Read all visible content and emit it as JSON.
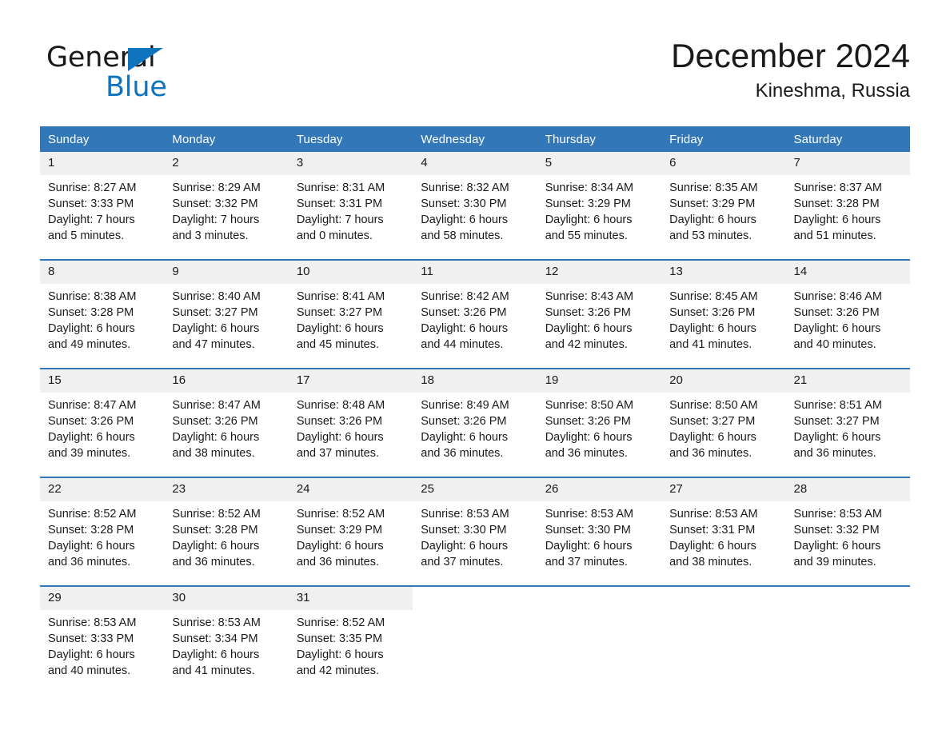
{
  "brand": {
    "word_one": "General",
    "word_two": "Blue",
    "triangle_color": "#0f73bd",
    "text_color": "#1a1a1a"
  },
  "header": {
    "month_title": "December 2024",
    "location": "Kineshma, Russia"
  },
  "theme": {
    "header_blue": "#3277b8",
    "row_band": "#f0f0f0",
    "page_background": "#ffffff",
    "text": "#1a1a1a"
  },
  "calendar": {
    "day_headers": [
      "Sunday",
      "Monday",
      "Tuesday",
      "Wednesday",
      "Thursday",
      "Friday",
      "Saturday"
    ],
    "weeks": [
      [
        {
          "day": "1",
          "sunrise": "Sunrise: 8:27 AM",
          "sunset": "Sunset: 3:33 PM",
          "daylight_line1": "Daylight: 7 hours",
          "daylight_line2": "and 5 minutes."
        },
        {
          "day": "2",
          "sunrise": "Sunrise: 8:29 AM",
          "sunset": "Sunset: 3:32 PM",
          "daylight_line1": "Daylight: 7 hours",
          "daylight_line2": "and 3 minutes."
        },
        {
          "day": "3",
          "sunrise": "Sunrise: 8:31 AM",
          "sunset": "Sunset: 3:31 PM",
          "daylight_line1": "Daylight: 7 hours",
          "daylight_line2": "and 0 minutes."
        },
        {
          "day": "4",
          "sunrise": "Sunrise: 8:32 AM",
          "sunset": "Sunset: 3:30 PM",
          "daylight_line1": "Daylight: 6 hours",
          "daylight_line2": "and 58 minutes."
        },
        {
          "day": "5",
          "sunrise": "Sunrise: 8:34 AM",
          "sunset": "Sunset: 3:29 PM",
          "daylight_line1": "Daylight: 6 hours",
          "daylight_line2": "and 55 minutes."
        },
        {
          "day": "6",
          "sunrise": "Sunrise: 8:35 AM",
          "sunset": "Sunset: 3:29 PM",
          "daylight_line1": "Daylight: 6 hours",
          "daylight_line2": "and 53 minutes."
        },
        {
          "day": "7",
          "sunrise": "Sunrise: 8:37 AM",
          "sunset": "Sunset: 3:28 PM",
          "daylight_line1": "Daylight: 6 hours",
          "daylight_line2": "and 51 minutes."
        }
      ],
      [
        {
          "day": "8",
          "sunrise": "Sunrise: 8:38 AM",
          "sunset": "Sunset: 3:28 PM",
          "daylight_line1": "Daylight: 6 hours",
          "daylight_line2": "and 49 minutes."
        },
        {
          "day": "9",
          "sunrise": "Sunrise: 8:40 AM",
          "sunset": "Sunset: 3:27 PM",
          "daylight_line1": "Daylight: 6 hours",
          "daylight_line2": "and 47 minutes."
        },
        {
          "day": "10",
          "sunrise": "Sunrise: 8:41 AM",
          "sunset": "Sunset: 3:27 PM",
          "daylight_line1": "Daylight: 6 hours",
          "daylight_line2": "and 45 minutes."
        },
        {
          "day": "11",
          "sunrise": "Sunrise: 8:42 AM",
          "sunset": "Sunset: 3:26 PM",
          "daylight_line1": "Daylight: 6 hours",
          "daylight_line2": "and 44 minutes."
        },
        {
          "day": "12",
          "sunrise": "Sunrise: 8:43 AM",
          "sunset": "Sunset: 3:26 PM",
          "daylight_line1": "Daylight: 6 hours",
          "daylight_line2": "and 42 minutes."
        },
        {
          "day": "13",
          "sunrise": "Sunrise: 8:45 AM",
          "sunset": "Sunset: 3:26 PM",
          "daylight_line1": "Daylight: 6 hours",
          "daylight_line2": "and 41 minutes."
        },
        {
          "day": "14",
          "sunrise": "Sunrise: 8:46 AM",
          "sunset": "Sunset: 3:26 PM",
          "daylight_line1": "Daylight: 6 hours",
          "daylight_line2": "and 40 minutes."
        }
      ],
      [
        {
          "day": "15",
          "sunrise": "Sunrise: 8:47 AM",
          "sunset": "Sunset: 3:26 PM",
          "daylight_line1": "Daylight: 6 hours",
          "daylight_line2": "and 39 minutes."
        },
        {
          "day": "16",
          "sunrise": "Sunrise: 8:47 AM",
          "sunset": "Sunset: 3:26 PM",
          "daylight_line1": "Daylight: 6 hours",
          "daylight_line2": "and 38 minutes."
        },
        {
          "day": "17",
          "sunrise": "Sunrise: 8:48 AM",
          "sunset": "Sunset: 3:26 PM",
          "daylight_line1": "Daylight: 6 hours",
          "daylight_line2": "and 37 minutes."
        },
        {
          "day": "18",
          "sunrise": "Sunrise: 8:49 AM",
          "sunset": "Sunset: 3:26 PM",
          "daylight_line1": "Daylight: 6 hours",
          "daylight_line2": "and 36 minutes."
        },
        {
          "day": "19",
          "sunrise": "Sunrise: 8:50 AM",
          "sunset": "Sunset: 3:26 PM",
          "daylight_line1": "Daylight: 6 hours",
          "daylight_line2": "and 36 minutes."
        },
        {
          "day": "20",
          "sunrise": "Sunrise: 8:50 AM",
          "sunset": "Sunset: 3:27 PM",
          "daylight_line1": "Daylight: 6 hours",
          "daylight_line2": "and 36 minutes."
        },
        {
          "day": "21",
          "sunrise": "Sunrise: 8:51 AM",
          "sunset": "Sunset: 3:27 PM",
          "daylight_line1": "Daylight: 6 hours",
          "daylight_line2": "and 36 minutes."
        }
      ],
      [
        {
          "day": "22",
          "sunrise": "Sunrise: 8:52 AM",
          "sunset": "Sunset: 3:28 PM",
          "daylight_line1": "Daylight: 6 hours",
          "daylight_line2": "and 36 minutes."
        },
        {
          "day": "23",
          "sunrise": "Sunrise: 8:52 AM",
          "sunset": "Sunset: 3:28 PM",
          "daylight_line1": "Daylight: 6 hours",
          "daylight_line2": "and 36 minutes."
        },
        {
          "day": "24",
          "sunrise": "Sunrise: 8:52 AM",
          "sunset": "Sunset: 3:29 PM",
          "daylight_line1": "Daylight: 6 hours",
          "daylight_line2": "and 36 minutes."
        },
        {
          "day": "25",
          "sunrise": "Sunrise: 8:53 AM",
          "sunset": "Sunset: 3:30 PM",
          "daylight_line1": "Daylight: 6 hours",
          "daylight_line2": "and 37 minutes."
        },
        {
          "day": "26",
          "sunrise": "Sunrise: 8:53 AM",
          "sunset": "Sunset: 3:30 PM",
          "daylight_line1": "Daylight: 6 hours",
          "daylight_line2": "and 37 minutes."
        },
        {
          "day": "27",
          "sunrise": "Sunrise: 8:53 AM",
          "sunset": "Sunset: 3:31 PM",
          "daylight_line1": "Daylight: 6 hours",
          "daylight_line2": "and 38 minutes."
        },
        {
          "day": "28",
          "sunrise": "Sunrise: 8:53 AM",
          "sunset": "Sunset: 3:32 PM",
          "daylight_line1": "Daylight: 6 hours",
          "daylight_line2": "and 39 minutes."
        }
      ],
      [
        {
          "day": "29",
          "sunrise": "Sunrise: 8:53 AM",
          "sunset": "Sunset: 3:33 PM",
          "daylight_line1": "Daylight: 6 hours",
          "daylight_line2": "and 40 minutes."
        },
        {
          "day": "30",
          "sunrise": "Sunrise: 8:53 AM",
          "sunset": "Sunset: 3:34 PM",
          "daylight_line1": "Daylight: 6 hours",
          "daylight_line2": "and 41 minutes."
        },
        {
          "day": "31",
          "sunrise": "Sunrise: 8:52 AM",
          "sunset": "Sunset: 3:35 PM",
          "daylight_line1": "Daylight: 6 hours",
          "daylight_line2": "and 42 minutes."
        },
        {
          "day": "",
          "sunrise": "",
          "sunset": "",
          "daylight_line1": "",
          "daylight_line2": ""
        },
        {
          "day": "",
          "sunrise": "",
          "sunset": "",
          "daylight_line1": "",
          "daylight_line2": ""
        },
        {
          "day": "",
          "sunrise": "",
          "sunset": "",
          "daylight_line1": "",
          "daylight_line2": ""
        },
        {
          "day": "",
          "sunrise": "",
          "sunset": "",
          "daylight_line1": "",
          "daylight_line2": ""
        }
      ]
    ]
  }
}
